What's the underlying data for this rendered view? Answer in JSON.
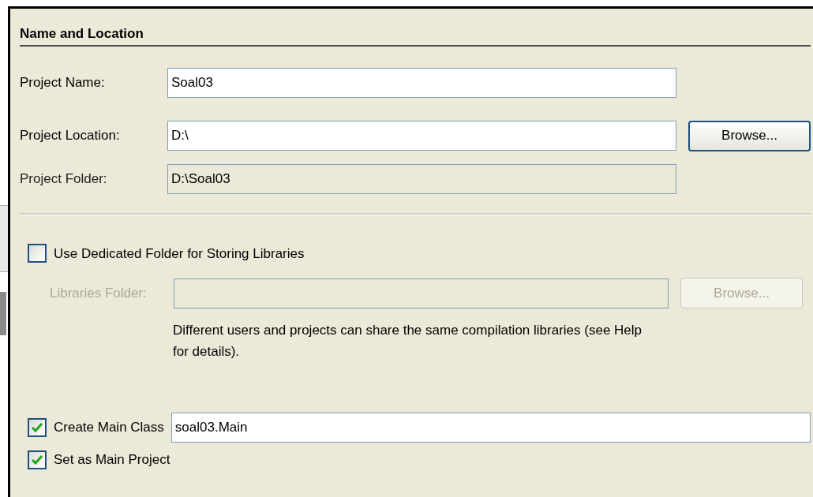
{
  "section": {
    "title": "Name and Location"
  },
  "fields": [
    {
      "label": "Project Name:",
      "value": "Soal03",
      "disabled": false
    },
    {
      "label": "Project Location:",
      "value": "D:\\",
      "disabled": false,
      "button": {
        "label": "Browse...",
        "disabled": false
      }
    },
    {
      "label": "Project Folder:",
      "value": "D:\\Soal03",
      "disabled": true
    }
  ],
  "libraries": {
    "checkbox": {
      "label": "Use Dedicated Folder for Storing Libraries",
      "checked": false
    },
    "field": {
      "label": "Libraries Folder:",
      "disabled": true
    },
    "button": {
      "label": "Browse...",
      "disabled": true
    },
    "help": "Different users and projects can share the same compilation libraries (see Help for details)."
  },
  "main_class": {
    "label": "Create Main Class",
    "checked": true,
    "value": "soal03.Main"
  },
  "main_project": {
    "label": "Set as Main Project",
    "checked": true
  }
}
